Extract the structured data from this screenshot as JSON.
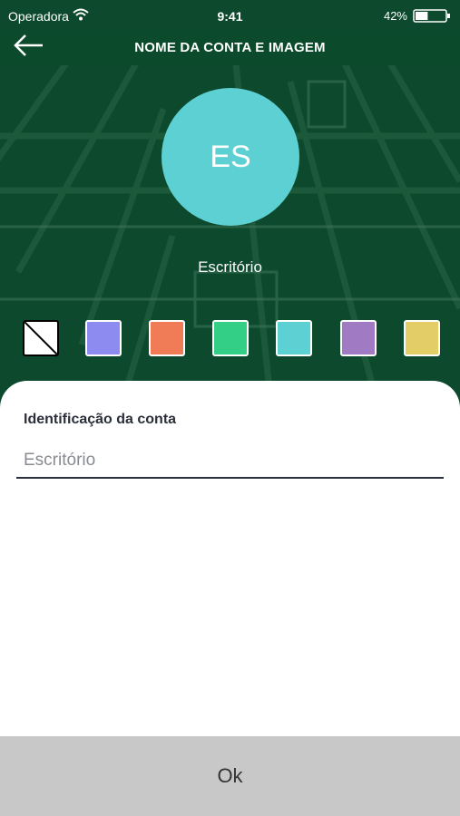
{
  "status_bar": {
    "carrier": "Operadora",
    "time": "9:41",
    "battery_percent": "42%",
    "battery_level": 0.42
  },
  "nav": {
    "title": "NOME DA CONTA E IMAGEM",
    "back_icon": "arrow-left-icon"
  },
  "avatar": {
    "initials": "ES",
    "color": "#5dd0d3"
  },
  "account_name": "Escritório",
  "swatches": [
    {
      "name": "none",
      "color": "#ffffff"
    },
    {
      "name": "blue",
      "color": "#8e8bf0"
    },
    {
      "name": "orange",
      "color": "#ef7b57"
    },
    {
      "name": "green",
      "color": "#33cf86"
    },
    {
      "name": "cyan",
      "color": "#5dd0d3"
    },
    {
      "name": "purple",
      "color": "#a07bc4"
    },
    {
      "name": "yellow",
      "color": "#e3cd66"
    }
  ],
  "form": {
    "label": "Identificação da conta",
    "placeholder": "Escritório"
  },
  "ok_label": "Ok"
}
